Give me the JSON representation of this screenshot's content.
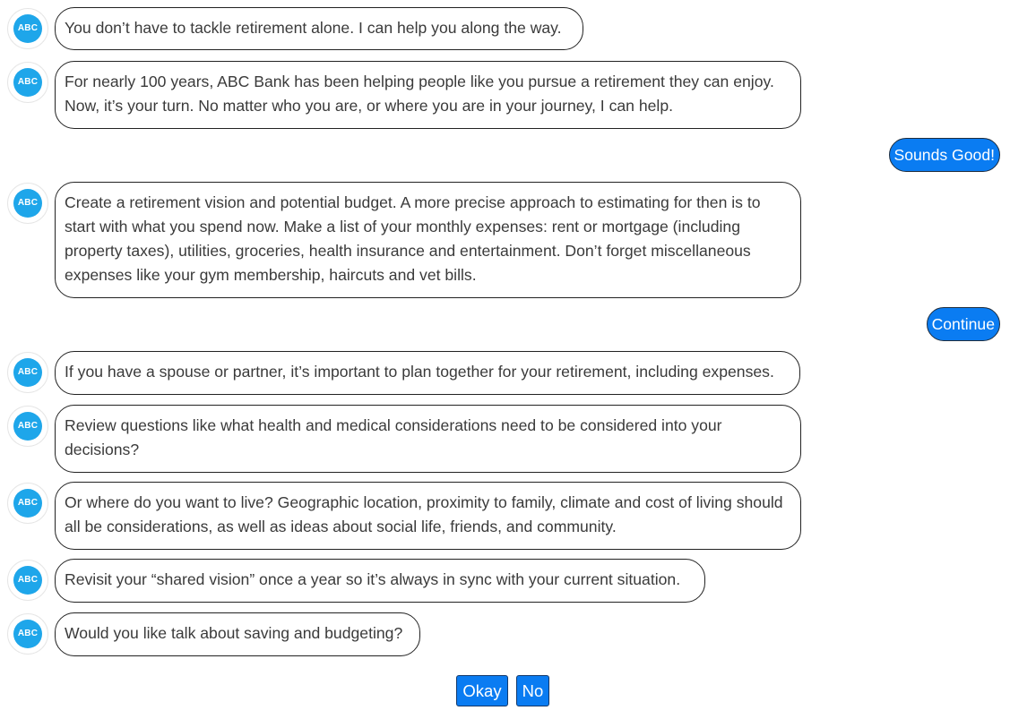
{
  "bot": {
    "avatar_text": "ABC"
  },
  "messages": [
    {
      "text": "You don’t have to tackle retirement alone. I can help you along the way."
    },
    {
      "text": "For nearly 100 years, ABC Bank has been helping people like you pursue a retirement they can enjoy. Now, it’s your turn. No matter who you are, or where you are in your journey, I can help."
    },
    {
      "text": "Create a retirement vision and potential budget. A more precise approach to estimating for then is to start with what you spend now. Make a list of your monthly expenses: rent or mortgage (including property taxes), utilities, groceries, health insurance and entertainment. Don’t forget miscellaneous expenses like your gym membership, haircuts and vet bills."
    },
    {
      "text": "If you have a spouse or partner, it’s important to plan together for your retirement, including expenses."
    },
    {
      "text": "Review questions like what health and medical considerations need to be considered into your decisions?"
    },
    {
      "text": "Or where do you want to live? Geographic location, proximity to family, climate and cost of living should all be considerations, as well as ideas about social life, friends, and community."
    },
    {
      "text": "Revisit your “shared vision” once a year so it’s always in sync with your current situation."
    },
    {
      "text": "Would you like talk about saving and budgeting?"
    }
  ],
  "user_replies": [
    {
      "text": "Sounds Good!"
    },
    {
      "text": "Continue"
    }
  ],
  "quick_replies": {
    "okay": "Okay",
    "no": "No"
  },
  "colors": {
    "user_bubble": "#0a7cf2",
    "avatar": "#1ea6ea",
    "bubble_border": "#222222"
  }
}
